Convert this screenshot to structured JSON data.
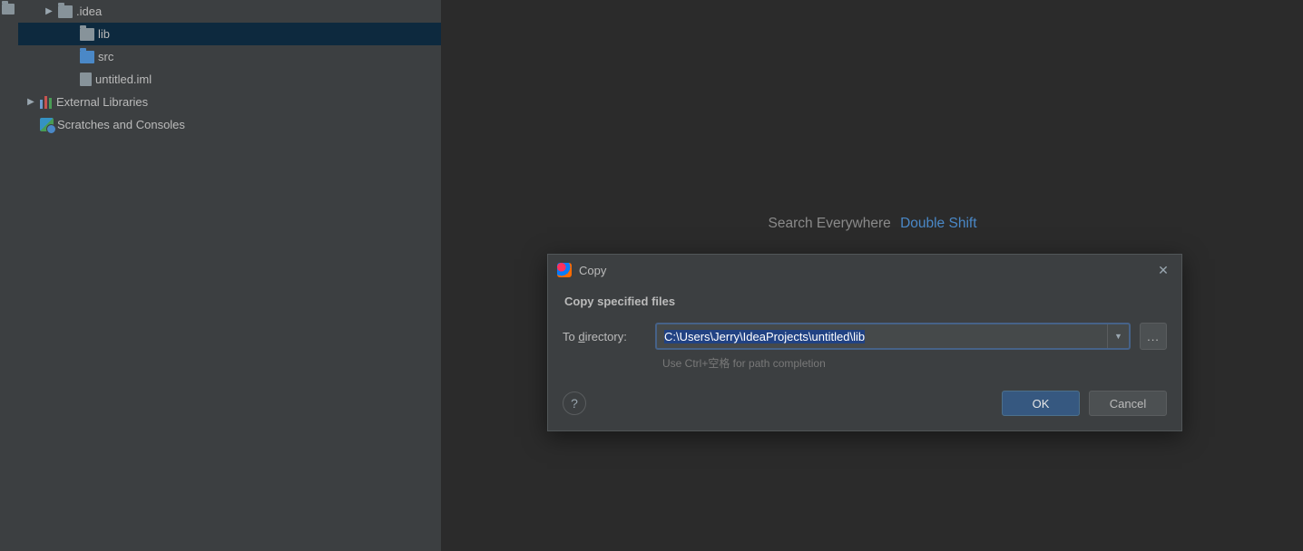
{
  "tree": {
    "idea": ".idea",
    "lib": "lib",
    "src": "src",
    "iml": "untitled.iml",
    "ext": "External Libraries",
    "scratch": "Scratches and Consoles"
  },
  "editor": {
    "hint_label": "Search Everywhere",
    "hint_key": "Double Shift"
  },
  "dialog": {
    "title": "Copy",
    "subtitle": "Copy specified files",
    "field_label_pre": "To ",
    "field_label_u": "d",
    "field_label_post": "irectory:",
    "path_value": "C:\\Users\\Jerry\\IdeaProjects\\untitled\\lib",
    "helper": "Use Ctrl+空格 for path completion",
    "ok": "OK",
    "cancel": "Cancel",
    "browse": "...",
    "help": "?"
  }
}
